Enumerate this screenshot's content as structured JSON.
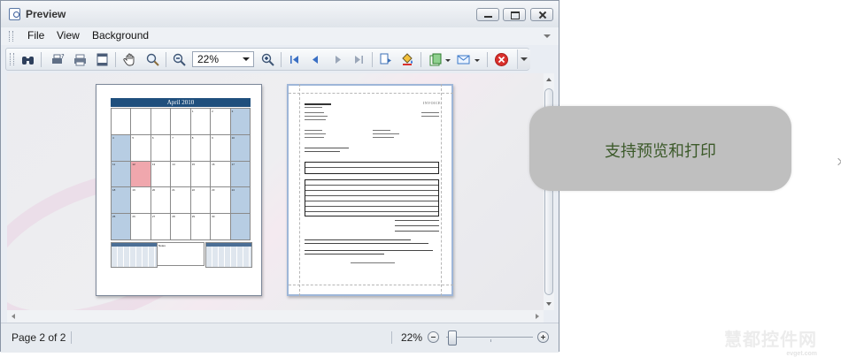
{
  "window": {
    "title": "Preview"
  },
  "menu": {
    "items": [
      "File",
      "View",
      "Background"
    ]
  },
  "toolbar": {
    "zoom_value": "22%"
  },
  "calendar_page": {
    "header": "April 2010",
    "notes_label": "Notes"
  },
  "invoice_page": {
    "heading": "INVOICE"
  },
  "callout": {
    "text": "支持预览和打印"
  },
  "status": {
    "page_label": "Page 2 of 2",
    "zoom_percent": "22%"
  },
  "zoom_slider_level": 0.02,
  "watermark": {
    "main": "慧都控件网",
    "sub": "evget.com"
  },
  "colors": {
    "calendar_header": "#1f4f7d",
    "weekend": "#b7cde3",
    "event": "#f0a7ad",
    "callout_bg": "#bfbfbf",
    "callout_text": "#3c5a2a",
    "close_red": "#d9302c"
  }
}
